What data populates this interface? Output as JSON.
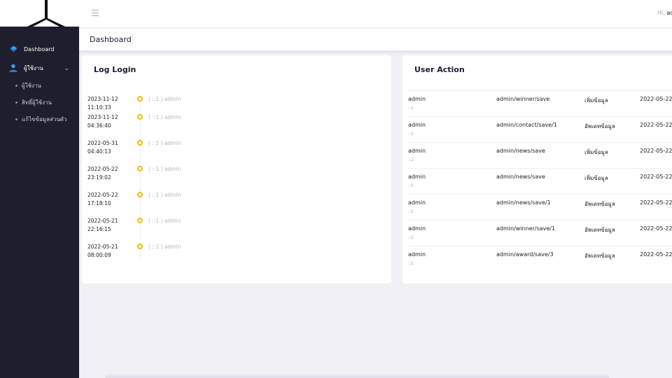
{
  "sidebar": {
    "items": [
      {
        "label": "Dashboard",
        "icon": "layers-icon"
      },
      {
        "label": "ผู้ใช้งาน",
        "icon": "user-icon",
        "expanded": true
      }
    ],
    "subitems": [
      {
        "label": "ผู้ใช้งาน"
      },
      {
        "label": "สิทธิ์ผู้ใช้งาน"
      },
      {
        "label": "แก้ไขข้อมูลส่วนตัว"
      }
    ]
  },
  "header": {
    "greeting_prefix": "Hi,",
    "user": "ad"
  },
  "breadcrumb": {
    "title": "Dashboard"
  },
  "log_login": {
    "title": "Log Login",
    "entries": [
      {
        "time": "2023-11-12 11:10:33",
        "text": "( ::1 ) admin"
      },
      {
        "time": "2023-11-12 04:36:40",
        "text": "( ::1 ) admin"
      },
      {
        "time": "2022-05-31 04:40:13",
        "text": "( ::1 ) admin"
      },
      {
        "time": "2022-05-22 23:19:02",
        "text": "( ::1 ) admin"
      },
      {
        "time": "2022-05-22 17:18:10",
        "text": "( ::1 ) admin"
      },
      {
        "time": "2022-05-21 22:16:15",
        "text": "( ::1 ) admin"
      },
      {
        "time": "2022-05-21 08:00:09",
        "text": "( ::1 ) admin"
      }
    ]
  },
  "user_action": {
    "title": "User Action",
    "rows": [
      {
        "user": "admin",
        "ip": "::1",
        "path": "admin/winner/save",
        "action": "เพิ่มข้อมูล",
        "date": "2022-05-22"
      },
      {
        "user": "admin",
        "ip": "::1",
        "path": "admin/contact/save/1",
        "action": "อัพเดทข้อมูล",
        "date": "2022-05-22"
      },
      {
        "user": "admin",
        "ip": "::1",
        "path": "admin/news/save",
        "action": "เพิ่มข้อมูล",
        "date": "2022-05-22"
      },
      {
        "user": "admin",
        "ip": "::1",
        "path": "admin/news/save",
        "action": "เพิ่มข้อมูล",
        "date": "2022-05-22"
      },
      {
        "user": "admin",
        "ip": "::1",
        "path": "admin/news/save/1",
        "action": "อัพเดทข้อมูล",
        "date": "2022-05-22"
      },
      {
        "user": "admin",
        "ip": "::1",
        "path": "admin/winner/save/1",
        "action": "อัพเดทข้อมูล",
        "date": "2022-05-22"
      },
      {
        "user": "admin",
        "ip": "::1",
        "path": "admin/award/save/3",
        "action": "อัพเดทข้อมูล",
        "date": "2022-05-22"
      }
    ]
  },
  "colors": {
    "sidebar_bg": "#1e1e2d",
    "accent": "#3699ff",
    "timeline_dot": "#f1bc00"
  }
}
